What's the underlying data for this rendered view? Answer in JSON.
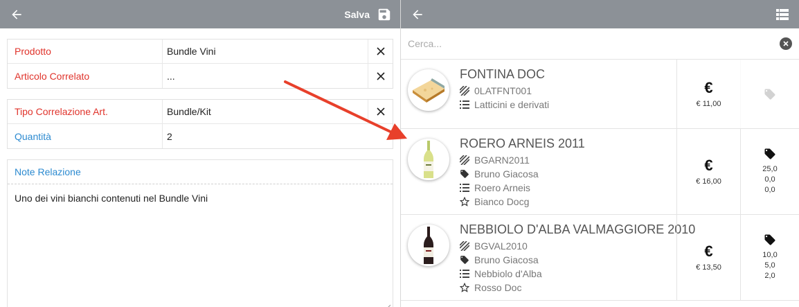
{
  "left_panel": {
    "save_label": "Salva",
    "rows_group1": [
      {
        "label": "Prodotto",
        "value": "Bundle Vini"
      },
      {
        "label": "Articolo Correlato",
        "value": "..."
      }
    ],
    "rows_group2": [
      {
        "label": "Tipo Correlazione Art.",
        "value": "Bundle/Kit"
      },
      {
        "label": "Quantità",
        "value": "2"
      }
    ],
    "note": {
      "label": "Note Relazione",
      "text": "Uno dei vini bianchi contenuti nel Bundle Vini"
    }
  },
  "right_panel": {
    "search_placeholder": "Cerca...",
    "products": [
      {
        "name": "FONTINA DOC",
        "code": "0LATFNT001",
        "category": "Latticini e derivati",
        "price": "€ 11,00"
      },
      {
        "name": "ROERO ARNEIS 2011",
        "code": "BGARN2011",
        "producer": "Bruno Giacosa",
        "category": "Roero Arneis",
        "type": "Bianco Docg",
        "price": "€ 16,00",
        "discounts": [
          "25,0",
          "0,0",
          "0,0"
        ]
      },
      {
        "name": "NEBBIOLO D'ALBA VALMAGGIORE 2010",
        "code": "BGVAL2010",
        "producer": "Bruno Giacosa",
        "category": "Nebbiolo d'Alba",
        "type": "Rosso Doc",
        "price": "€ 13,50",
        "discounts": [
          "10,0",
          "5,0",
          "2,0"
        ]
      }
    ]
  },
  "currency_symbol": "€",
  "colors": {
    "topbar": "#8c9197",
    "required_label": "#e0332b",
    "optional_label": "#2c8ad0",
    "arrow": "#e8402b"
  }
}
